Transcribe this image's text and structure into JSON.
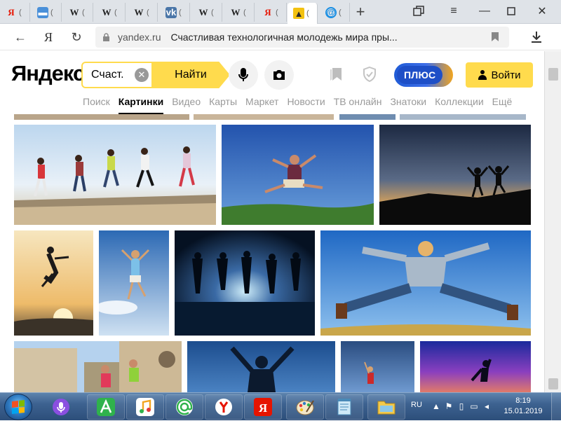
{
  "browser": {
    "tabs": [
      {
        "icon": "yandex-favicon",
        "glyph": "Я",
        "trunc": "("
      },
      {
        "icon": "chat-favicon",
        "glyph": "",
        "trunc": "("
      },
      {
        "icon": "wikipedia-favicon",
        "glyph": "W",
        "trunc": "("
      },
      {
        "icon": "wikipedia-favicon",
        "glyph": "W",
        "trunc": "("
      },
      {
        "icon": "wikipedia-favicon",
        "glyph": "W",
        "trunc": "("
      },
      {
        "icon": "vk-favicon",
        "glyph": "vk",
        "trunc": "("
      },
      {
        "icon": "wikipedia-favicon",
        "glyph": "W",
        "trunc": "("
      },
      {
        "icon": "wikipedia-favicon",
        "glyph": "W",
        "trunc": "("
      },
      {
        "icon": "yandex-favicon",
        "glyph": "Я",
        "trunc": "("
      },
      {
        "icon": "images-favicon",
        "glyph": "",
        "trunc": "("
      },
      {
        "icon": "mail-favicon",
        "glyph": "@",
        "trunc": "("
      }
    ],
    "active_tab_index": 9,
    "address": {
      "domain": "yandex.ru",
      "page_title": "Счастливая технологичная молодежь мира пры..."
    }
  },
  "yandex": {
    "logo": "Яндекс",
    "search": {
      "query": "Счаст.",
      "button": "Найти"
    },
    "plus_label": "ПЛЮС",
    "login_label": "Войти",
    "services": [
      "Поиск",
      "Картинки",
      "Видео",
      "Карты",
      "Маркет",
      "Новости",
      "ТВ онлайн",
      "Знатоки",
      "Коллекции",
      "Ещё"
    ],
    "active_service_index": 1
  },
  "results": {
    "images": [
      {
        "subject": "group-jumping-on-pier",
        "colors": [
          "#cfe2f2",
          "#9fc4e6",
          "#d8cab0"
        ]
      },
      {
        "subject": "boy-jumping-blue-sky",
        "colors": [
          "#2a5cb3",
          "#4f86cf",
          "#3a7a35"
        ]
      },
      {
        "subject": "silhouettes-jumping-sunset",
        "colors": [
          "#1d2a44",
          "#52627e",
          "#d9a55a"
        ]
      },
      {
        "subject": "girl-silhouette-sunset-jump",
        "colors": [
          "#f6d99c",
          "#e9a95a",
          "#6b5a45"
        ]
      },
      {
        "subject": "girl-jumping-sky",
        "colors": [
          "#2f6bb5",
          "#7fb0e0",
          "#d6e6f4"
        ]
      },
      {
        "subject": "silhouettes-jumping-night-sea",
        "colors": [
          "#05111f",
          "#2a4a78",
          "#9fd3f2"
        ]
      },
      {
        "subject": "boy-jumping-blue-sky-spread",
        "colors": [
          "#2e7ad0",
          "#5fa4e6",
          "#a8d0f0"
        ]
      },
      {
        "subject": "kids-jumping-old-building",
        "colors": [
          "#d9c8a8",
          "#8a8f6a",
          "#4a84c0"
        ]
      },
      {
        "subject": "man-silhouette-arms-up",
        "colors": [
          "#1f4f8f",
          "#3d76b9",
          "#0c1e38"
        ]
      },
      {
        "subject": "man-jumping-dusk",
        "colors": [
          "#2a4f86",
          "#6d9bd3",
          "#c86b8e"
        ]
      },
      {
        "subject": "person-silhouette-sunset-purple",
        "colors": [
          "#3a2a8e",
          "#9a4fb8",
          "#e28a6e"
        ]
      }
    ]
  },
  "taskbar": {
    "apps": [
      "alice-assistant",
      "yandex-launcher",
      "music",
      "mail-agent",
      "yandex-browser",
      "yandex-app",
      "paint",
      "notepad",
      "file-explorer"
    ],
    "tray": {
      "lang": "RU",
      "time": "8:19",
      "date": "15.01.2019"
    }
  }
}
